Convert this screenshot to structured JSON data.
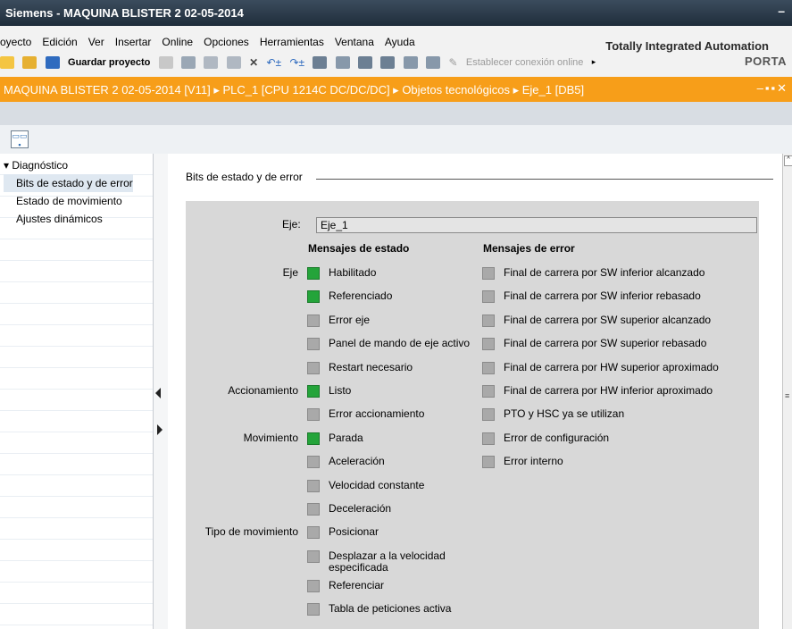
{
  "window": {
    "title": "Siemens  -  MAQUINA BLISTER 2 02-05-2014"
  },
  "menu": [
    "oyecto",
    "Edición",
    "Ver",
    "Insertar",
    "Online",
    "Opciones",
    "Herramientas",
    "Ventana",
    "Ayuda"
  ],
  "brand": {
    "line1": "Totally Integrated Automation",
    "line2": "PORTA"
  },
  "toolbar": {
    "save_label": "Guardar proyecto",
    "online_label": "Establecer conexión online"
  },
  "breadcrumb": {
    "text": "MAQUINA BLISTER 2 02-05-2014 [V11]  ▸  PLC_1 [CPU 1214C DC/DC/DC]  ▸  Objetos tecnológicos  ▸  Eje_1 [DB5]"
  },
  "tree": {
    "root": "▾ Diagnóstico",
    "items": [
      "Bits de estado y de error",
      "Estado de movimiento",
      "Ajustes dinámicos"
    ],
    "selected_index": 0
  },
  "section": {
    "title": "Bits de estado y de error"
  },
  "axis": {
    "label": "Eje:",
    "value": "Eje_1"
  },
  "status": {
    "header": "Mensajes de estado",
    "groups": [
      {
        "label": "Eje",
        "items": [
          {
            "text": "Habilitado",
            "on": true
          },
          {
            "text": "Referenciado",
            "on": true
          },
          {
            "text": "Error eje",
            "on": false
          },
          {
            "text": "Panel de mando de eje activo",
            "on": false
          },
          {
            "text": "Restart necesario",
            "on": false
          }
        ]
      },
      {
        "label": "Accionamiento",
        "items": [
          {
            "text": "Listo",
            "on": true
          },
          {
            "text": "Error accionamiento",
            "on": false
          }
        ]
      },
      {
        "label": "Movimiento",
        "items": [
          {
            "text": "Parada",
            "on": true
          },
          {
            "text": "Aceleración",
            "on": false
          },
          {
            "text": "Velocidad constante",
            "on": false
          },
          {
            "text": "Deceleración",
            "on": false
          }
        ]
      },
      {
        "label": "Tipo de movimiento",
        "items": [
          {
            "text": "Posicionar",
            "on": false
          },
          {
            "text": "Desplazar a la velocidad",
            "text2": "especificada",
            "on": false
          },
          {
            "text": "Referenciar",
            "on": false
          },
          {
            "text": "Tabla de peticiones activa",
            "on": false
          }
        ]
      }
    ]
  },
  "errors": {
    "header": "Mensajes de error",
    "items": [
      "Final de carrera por SW inferior alcanzado",
      "Final de carrera por SW inferior rebasado",
      "Final de carrera por SW superior alcanzado",
      "Final de carrera por SW superior rebasado",
      "Final de carrera por HW superior aproximado",
      "Final de carrera por HW inferior aproximado",
      "PTO y HSC ya se utilizan",
      "Error de configuración",
      "Error interno"
    ]
  },
  "colors": {
    "active": "#24a43a",
    "inactive": "#a9a9a9",
    "breadcrumb_bg": "#f79e19"
  }
}
